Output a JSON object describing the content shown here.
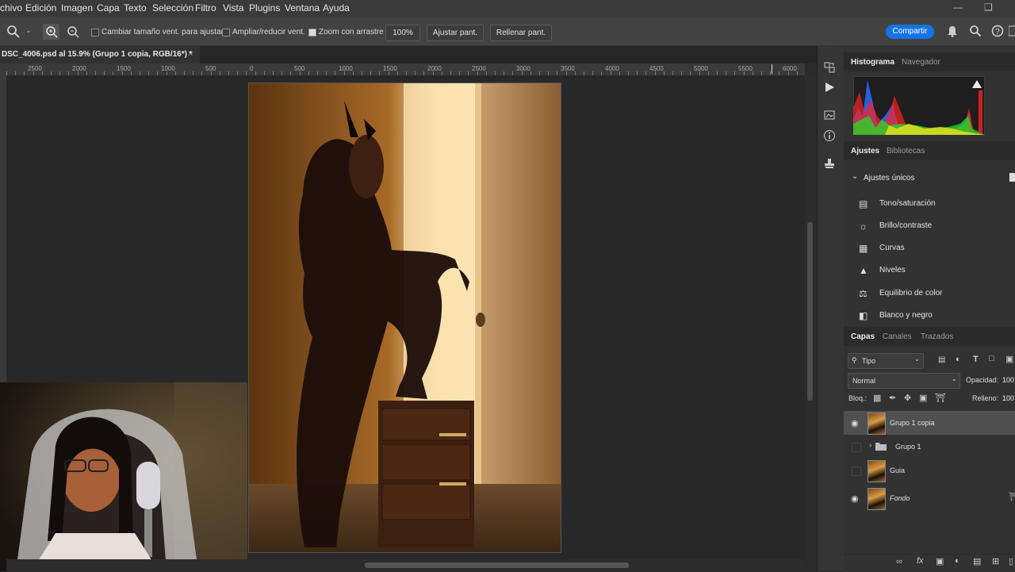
{
  "menu": [
    "chivo",
    "Edición",
    "Imagen",
    "Capa",
    "Texto",
    "Selección",
    "Filtro",
    "Vista",
    "Plugins",
    "Ventana",
    "Ayuda"
  ],
  "options": {
    "resize_windows_label": "Cambiar tamaño vent. para ajustar",
    "zoom_all_label": "Ampliar/reducir vent.",
    "scrubby_zoom_label": "Zoom con arrastre",
    "zoom_value": "100%",
    "fit_screen_label": "Ajustar pant.",
    "fill_screen_label": "Rellenar pant.",
    "share_label": "Compartir"
  },
  "document": {
    "tab_title": "DSC_4006.psd al 15.9% (Grupo 1 copia, RGB/16*) *",
    "close_glyph": "×"
  },
  "ruler_labels": [
    "2500",
    "2000",
    "1500",
    "1000",
    "500",
    "0",
    "500",
    "1000",
    "1500",
    "2000",
    "2500",
    "3000",
    "3500",
    "4000",
    "4500",
    "5000",
    "5500",
    "6000"
  ],
  "panels": {
    "histogram_tabs": [
      "Histograma",
      "Navegador"
    ],
    "adjust_tabs": [
      "Ajustes",
      "Bibliotecas"
    ],
    "adjust_section": "Ajustes únicos",
    "adjustments": [
      "Tono/saturación",
      "Brillo/contraste",
      "Curvas",
      "Niveles",
      "Equilibrio de color",
      "Blanco y negro"
    ],
    "layers_tabs": [
      "Capas",
      "Canales",
      "Trazados"
    ],
    "filter_kind": "Tipo",
    "blend_mode": "Normal",
    "opacity_label": "Opacidad:",
    "opacity_value": "100",
    "lock_label": "Bloq.:",
    "fill_label": "Relleno:",
    "fill_value": "100",
    "layers": [
      {
        "name": "Grupo 1 copia",
        "visible": true,
        "selected": true,
        "type": "layer"
      },
      {
        "name": "Grupo 1",
        "visible": false,
        "selected": false,
        "type": "group"
      },
      {
        "name": "Guia",
        "visible": false,
        "selected": false,
        "type": "layer"
      },
      {
        "name": "Fondo",
        "visible": true,
        "selected": false,
        "type": "background"
      }
    ]
  },
  "colors": {
    "accent": "#1473e6",
    "panel_bg": "#323232",
    "menubar_bg": "#3a3a3a"
  }
}
